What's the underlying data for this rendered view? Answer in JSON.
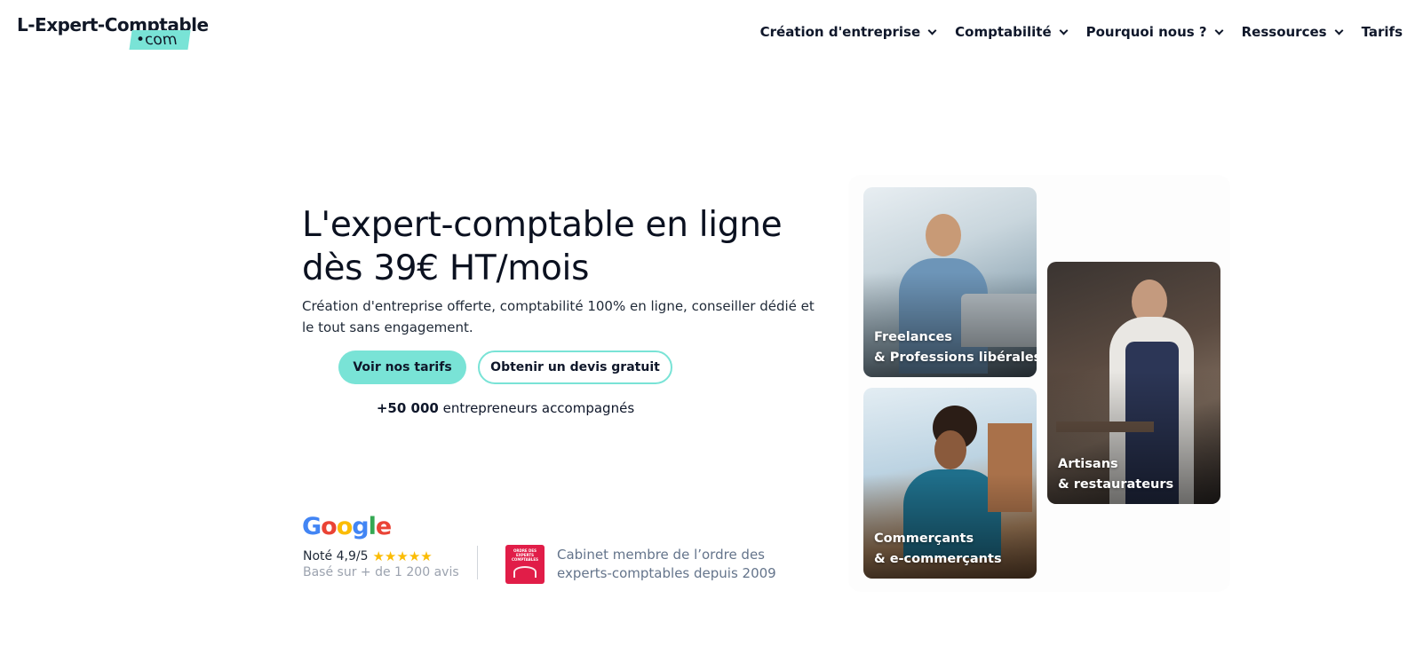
{
  "brand": {
    "name_main": "L-Expert-Comptable",
    "name_suffix": "com",
    "accent_color": "#79e3d6"
  },
  "nav": {
    "items": [
      {
        "label": "Création d'entreprise",
        "has_dropdown": true
      },
      {
        "label": "Comptabilité",
        "has_dropdown": true
      },
      {
        "label": "Pourquoi nous ?",
        "has_dropdown": true
      },
      {
        "label": "Ressources",
        "has_dropdown": true
      },
      {
        "label": "Tarifs",
        "has_dropdown": false
      }
    ]
  },
  "hero": {
    "title_line1": "L'expert-comptable en ligne",
    "title_line2": "dès 39€ HT/mois",
    "subtitle": "Création d'entreprise offerte, comptabilité 100% en ligne, conseiller dédié et le tout sans engagement.",
    "primary_button": "Voir nos tarifs",
    "secondary_button": "Obtenir un devis gratuit",
    "entrepreneurs_count": "+50 000",
    "entrepreneurs_label": "entrepreneurs accompagnés"
  },
  "trust": {
    "google_label": "Google",
    "rating_label": "Noté 4,9/5",
    "stars": "★★★★★",
    "rating_basis": "Basé sur + de 1 200 avis",
    "ordre_logo_text": "ORDRE DES EXPERTS COMPTABLES",
    "ordre_text": "Cabinet membre de l’ordre des experts-comptables depuis 2009"
  },
  "cards": [
    {
      "line1": "Freelances",
      "line2": "& Professions libérales"
    },
    {
      "line1": "Commerçants",
      "line2": "& e-commerçants"
    },
    {
      "line1": "Artisans",
      "line2": "& restaurateurs"
    }
  ]
}
